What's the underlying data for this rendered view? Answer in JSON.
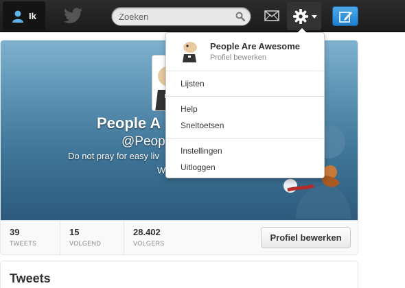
{
  "topbar": {
    "home_label": "Ik",
    "search_placeholder": "Zoeken"
  },
  "profile": {
    "name": "People Are Awesome",
    "name_partial": "People A",
    "handle_partial": "@People",
    "bio_partial": "Do not pray for easy liv",
    "bio_partial_2": "W",
    "edit_button": "Profiel bewerken"
  },
  "stats": [
    {
      "value": "39",
      "label": "TWEETS"
    },
    {
      "value": "15",
      "label": "VOLGEND"
    },
    {
      "value": "28.402",
      "label": "VOLGERS"
    }
  ],
  "tweets_title": "Tweets",
  "dropdown": {
    "profile_name": "People Are Awesome",
    "profile_sub": "Profiel bewerken",
    "items": [
      "Lijsten",
      "Help",
      "Sneltoetsen",
      "Instellingen",
      "Uitloggen"
    ]
  },
  "colors": {
    "topbar": "#1b1b1b",
    "compose_button": "#2a8ed8",
    "header_gradient_top": "#7fb1cf",
    "header_gradient_bottom": "#2c5a7c"
  }
}
